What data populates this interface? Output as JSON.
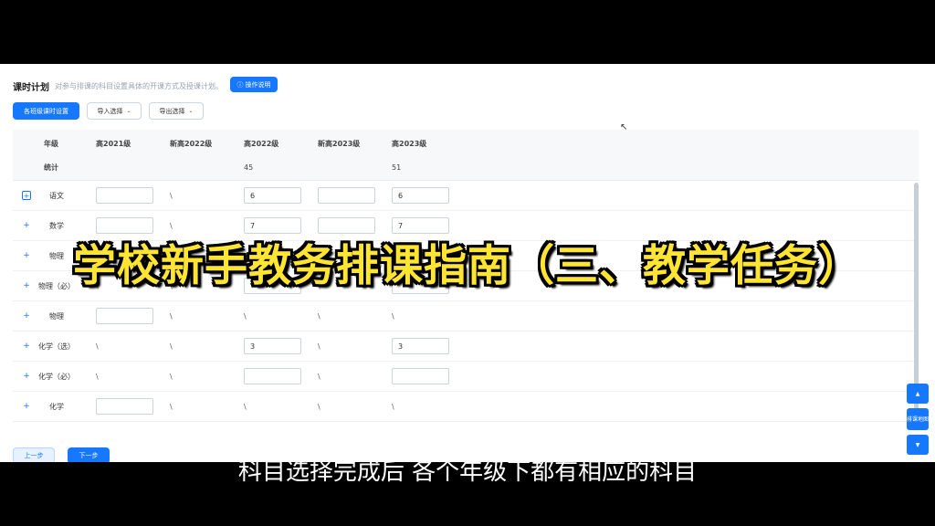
{
  "header": {
    "title": "课时计划",
    "description": "对参与排课的科目设置具体的开课方式及授课计划。",
    "guide_label": "操作说明"
  },
  "toolbar": {
    "batch_label": "各班级课时设置",
    "import_label": "导入选择",
    "export_label": "导出选择"
  },
  "table": {
    "columns": [
      "年级",
      "高2021级",
      "新高2022级",
      "高2022级",
      "新高2023级",
      "高2023级"
    ],
    "stats_label": "统计",
    "stats": [
      "",
      "",
      "45",
      "",
      "51"
    ],
    "rows": [
      {
        "subject": "语文",
        "cells": [
          "input:",
          "\\",
          "input:6",
          "input:",
          "input:6"
        ]
      },
      {
        "subject": "数学",
        "cells": [
          "input:",
          "\\",
          "input:7",
          "input:",
          "input:7"
        ]
      },
      {
        "subject": "物理",
        "cells": [
          "",
          "",
          "",
          "",
          ""
        ]
      },
      {
        "subject": "物理（必）",
        "cells": [
          "\\",
          "\\",
          "input:",
          "\\",
          "input:"
        ]
      },
      {
        "subject": "物理",
        "cells": [
          "input:",
          "\\",
          "\\",
          "\\",
          "\\"
        ]
      },
      {
        "subject": "化学（选）",
        "cells": [
          "\\",
          "\\",
          "input:3",
          "\\",
          "input:3"
        ]
      },
      {
        "subject": "化学（必）",
        "cells": [
          "\\",
          "\\",
          "input:",
          "\\",
          "input:"
        ]
      },
      {
        "subject": "化学",
        "cells": [
          "input:",
          "\\",
          "\\",
          "\\",
          "\\"
        ]
      }
    ]
  },
  "footer": {
    "prev_label": "上一步",
    "next_label": "下一步"
  },
  "float_tools": {
    "top_icon": "arrow-up-icon",
    "map_label": "排课地图",
    "bottom_icon": "arrow-down-icon"
  },
  "overlay": {
    "title": "学校新手教务排课指南（三、教学任务）",
    "subtitle": "科目选择完成后 各个年级下都有相应的科目"
  },
  "colors": {
    "accent": "#1677ff",
    "title_yellow": "#ffe533"
  }
}
